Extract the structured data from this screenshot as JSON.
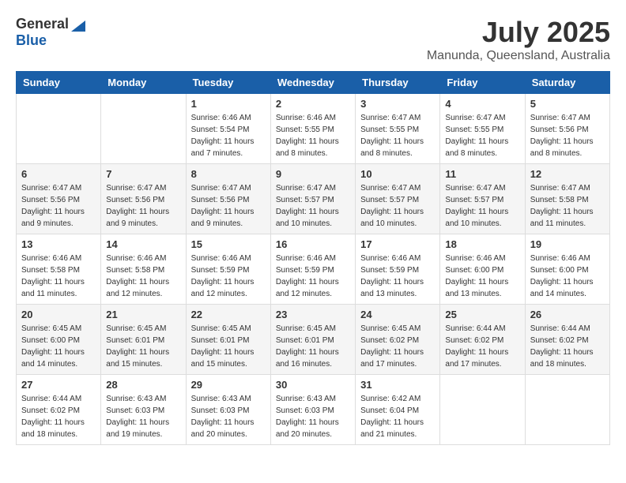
{
  "logo": {
    "general": "General",
    "blue": "Blue"
  },
  "title": "July 2025",
  "subtitle": "Manunda, Queensland, Australia",
  "days_header": [
    "Sunday",
    "Monday",
    "Tuesday",
    "Wednesday",
    "Thursday",
    "Friday",
    "Saturday"
  ],
  "weeks": [
    [
      {
        "day": "",
        "info": ""
      },
      {
        "day": "",
        "info": ""
      },
      {
        "day": "1",
        "info": "Sunrise: 6:46 AM\nSunset: 5:54 PM\nDaylight: 11 hours and 7 minutes."
      },
      {
        "day": "2",
        "info": "Sunrise: 6:46 AM\nSunset: 5:55 PM\nDaylight: 11 hours and 8 minutes."
      },
      {
        "day": "3",
        "info": "Sunrise: 6:47 AM\nSunset: 5:55 PM\nDaylight: 11 hours and 8 minutes."
      },
      {
        "day": "4",
        "info": "Sunrise: 6:47 AM\nSunset: 5:55 PM\nDaylight: 11 hours and 8 minutes."
      },
      {
        "day": "5",
        "info": "Sunrise: 6:47 AM\nSunset: 5:56 PM\nDaylight: 11 hours and 8 minutes."
      }
    ],
    [
      {
        "day": "6",
        "info": "Sunrise: 6:47 AM\nSunset: 5:56 PM\nDaylight: 11 hours and 9 minutes."
      },
      {
        "day": "7",
        "info": "Sunrise: 6:47 AM\nSunset: 5:56 PM\nDaylight: 11 hours and 9 minutes."
      },
      {
        "day": "8",
        "info": "Sunrise: 6:47 AM\nSunset: 5:56 PM\nDaylight: 11 hours and 9 minutes."
      },
      {
        "day": "9",
        "info": "Sunrise: 6:47 AM\nSunset: 5:57 PM\nDaylight: 11 hours and 10 minutes."
      },
      {
        "day": "10",
        "info": "Sunrise: 6:47 AM\nSunset: 5:57 PM\nDaylight: 11 hours and 10 minutes."
      },
      {
        "day": "11",
        "info": "Sunrise: 6:47 AM\nSunset: 5:57 PM\nDaylight: 11 hours and 10 minutes."
      },
      {
        "day": "12",
        "info": "Sunrise: 6:47 AM\nSunset: 5:58 PM\nDaylight: 11 hours and 11 minutes."
      }
    ],
    [
      {
        "day": "13",
        "info": "Sunrise: 6:46 AM\nSunset: 5:58 PM\nDaylight: 11 hours and 11 minutes."
      },
      {
        "day": "14",
        "info": "Sunrise: 6:46 AM\nSunset: 5:58 PM\nDaylight: 11 hours and 12 minutes."
      },
      {
        "day": "15",
        "info": "Sunrise: 6:46 AM\nSunset: 5:59 PM\nDaylight: 11 hours and 12 minutes."
      },
      {
        "day": "16",
        "info": "Sunrise: 6:46 AM\nSunset: 5:59 PM\nDaylight: 11 hours and 12 minutes."
      },
      {
        "day": "17",
        "info": "Sunrise: 6:46 AM\nSunset: 5:59 PM\nDaylight: 11 hours and 13 minutes."
      },
      {
        "day": "18",
        "info": "Sunrise: 6:46 AM\nSunset: 6:00 PM\nDaylight: 11 hours and 13 minutes."
      },
      {
        "day": "19",
        "info": "Sunrise: 6:46 AM\nSunset: 6:00 PM\nDaylight: 11 hours and 14 minutes."
      }
    ],
    [
      {
        "day": "20",
        "info": "Sunrise: 6:45 AM\nSunset: 6:00 PM\nDaylight: 11 hours and 14 minutes."
      },
      {
        "day": "21",
        "info": "Sunrise: 6:45 AM\nSunset: 6:01 PM\nDaylight: 11 hours and 15 minutes."
      },
      {
        "day": "22",
        "info": "Sunrise: 6:45 AM\nSunset: 6:01 PM\nDaylight: 11 hours and 15 minutes."
      },
      {
        "day": "23",
        "info": "Sunrise: 6:45 AM\nSunset: 6:01 PM\nDaylight: 11 hours and 16 minutes."
      },
      {
        "day": "24",
        "info": "Sunrise: 6:45 AM\nSunset: 6:02 PM\nDaylight: 11 hours and 17 minutes."
      },
      {
        "day": "25",
        "info": "Sunrise: 6:44 AM\nSunset: 6:02 PM\nDaylight: 11 hours and 17 minutes."
      },
      {
        "day": "26",
        "info": "Sunrise: 6:44 AM\nSunset: 6:02 PM\nDaylight: 11 hours and 18 minutes."
      }
    ],
    [
      {
        "day": "27",
        "info": "Sunrise: 6:44 AM\nSunset: 6:02 PM\nDaylight: 11 hours and 18 minutes."
      },
      {
        "day": "28",
        "info": "Sunrise: 6:43 AM\nSunset: 6:03 PM\nDaylight: 11 hours and 19 minutes."
      },
      {
        "day": "29",
        "info": "Sunrise: 6:43 AM\nSunset: 6:03 PM\nDaylight: 11 hours and 20 minutes."
      },
      {
        "day": "30",
        "info": "Sunrise: 6:43 AM\nSunset: 6:03 PM\nDaylight: 11 hours and 20 minutes."
      },
      {
        "day": "31",
        "info": "Sunrise: 6:42 AM\nSunset: 6:04 PM\nDaylight: 11 hours and 21 minutes."
      },
      {
        "day": "",
        "info": ""
      },
      {
        "day": "",
        "info": ""
      }
    ]
  ]
}
